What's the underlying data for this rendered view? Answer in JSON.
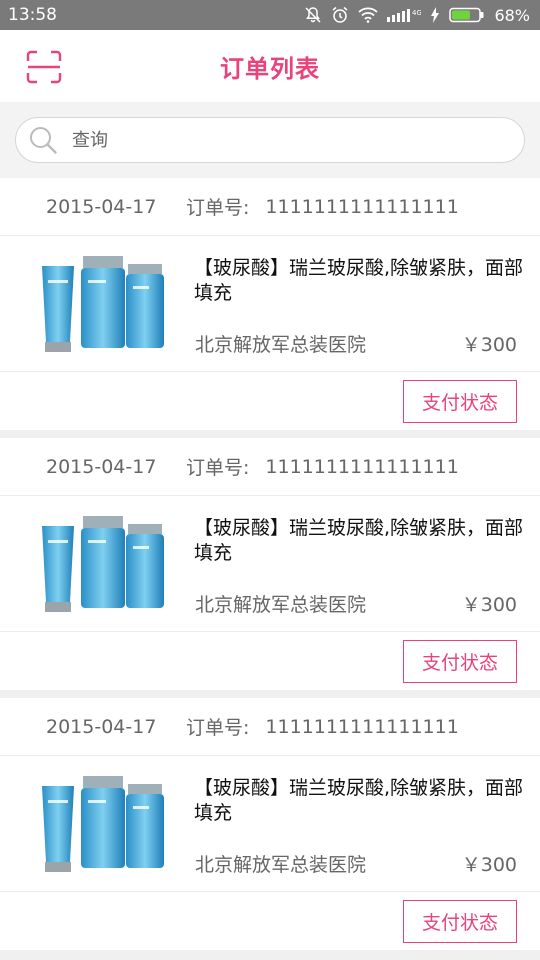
{
  "status_bar": {
    "time": "13:58",
    "battery": "68%",
    "icons": [
      "mute-icon",
      "alarm-icon",
      "wifi-icon",
      "signal-icon",
      "charging-icon",
      "battery-icon"
    ]
  },
  "header": {
    "title": "订单列表",
    "scan_icon": "scan-icon"
  },
  "search": {
    "placeholder": "查询",
    "value": ""
  },
  "colors": {
    "accent": "#e8437a",
    "status_bar": "#7a7a7a",
    "battery": "#6fd33d"
  },
  "orders": [
    {
      "date": "2015-04-17",
      "order_no_label": "订单号:",
      "order_no": "1111111111111111",
      "product_name": "【玻尿酸】瑞兰玻尿酸,除皱紧肤，面部填充",
      "hospital": "北京解放军总装医院",
      "price": "￥300",
      "pay_status_label": "支付状态"
    },
    {
      "date": "2015-04-17",
      "order_no_label": "订单号:",
      "order_no": "1111111111111111",
      "product_name": "【玻尿酸】瑞兰玻尿酸,除皱紧肤，面部填充",
      "hospital": "北京解放军总装医院",
      "price": "￥300",
      "pay_status_label": "支付状态"
    },
    {
      "date": "2015-04-17",
      "order_no_label": "订单号:",
      "order_no": "1111111111111111",
      "product_name": "【玻尿酸】瑞兰玻尿酸,除皱紧肤，面部填充",
      "hospital": "北京解放军总装医院",
      "price": "￥300",
      "pay_status_label": "支付状态"
    }
  ]
}
